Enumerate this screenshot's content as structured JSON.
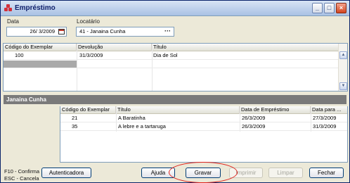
{
  "window": {
    "title": "Empréstimo"
  },
  "form": {
    "date_label": "Data",
    "date_value": "26/ 3/2009",
    "tenant_label": "Locatário",
    "tenant_value": "41 - Janaina Cunha"
  },
  "grid1": {
    "columns": [
      "Código do Exemplar",
      "Devolução",
      "Título"
    ],
    "rows": [
      [
        "100",
        "31/3/2009",
        "Dia de Sol"
      ]
    ]
  },
  "section": {
    "title": "Janaina Cunha"
  },
  "grid2": {
    "columns": [
      "Código do Exemplar",
      "Título",
      "Data de Empréstimo",
      "Data para ..."
    ],
    "rows": [
      [
        "21",
        "A Baratinha",
        "26/3/2009",
        "27/3/2009"
      ],
      [
        "35",
        "A lebre e a tartaruga",
        "26/3/2009",
        "31/3/2009"
      ]
    ]
  },
  "footer": {
    "hint1": "F10 - Confirma",
    "hint2": "ESC - Cancela",
    "buttons": {
      "autenticadora": "Autenticadora",
      "ajuda": "Ajuda",
      "gravar": "Gravar",
      "imprimir": "Imprimir",
      "limpar": "Limpar",
      "fechar": "Fechar"
    }
  },
  "colors": {
    "accent": "#e0241e",
    "section_bar": "#7a7a7a",
    "title_text": "#10206b"
  }
}
